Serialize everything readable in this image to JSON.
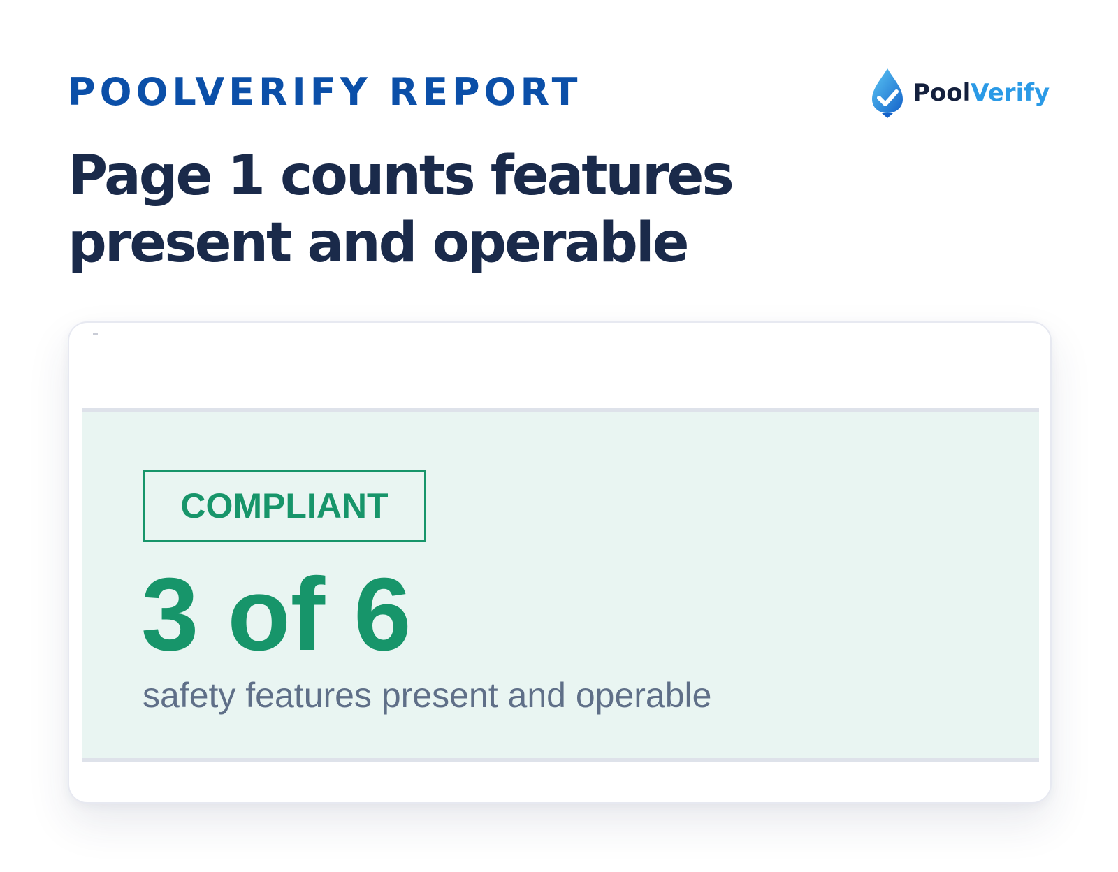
{
  "header": {
    "eyebrow": "POOLVERIFY REPORT",
    "headline": "Page 1 counts features present and operable"
  },
  "logo": {
    "icon": "water-drop-check-icon",
    "word_part1": "Pool",
    "word_part2": "Verify"
  },
  "card": {
    "status_badge": "COMPLIANT",
    "count_text": "3 of 6",
    "count_present": 3,
    "count_total": 6,
    "description": "safety features present and operable"
  },
  "colors": {
    "eyebrow": "#0b4fa8",
    "headline": "#1a2a4a",
    "compliant_green": "#17956a",
    "panel_background": "#e9f5f2",
    "description_gray": "#5f6f88",
    "logo_dark": "#14203d",
    "logo_blue": "#2b9ae6"
  }
}
